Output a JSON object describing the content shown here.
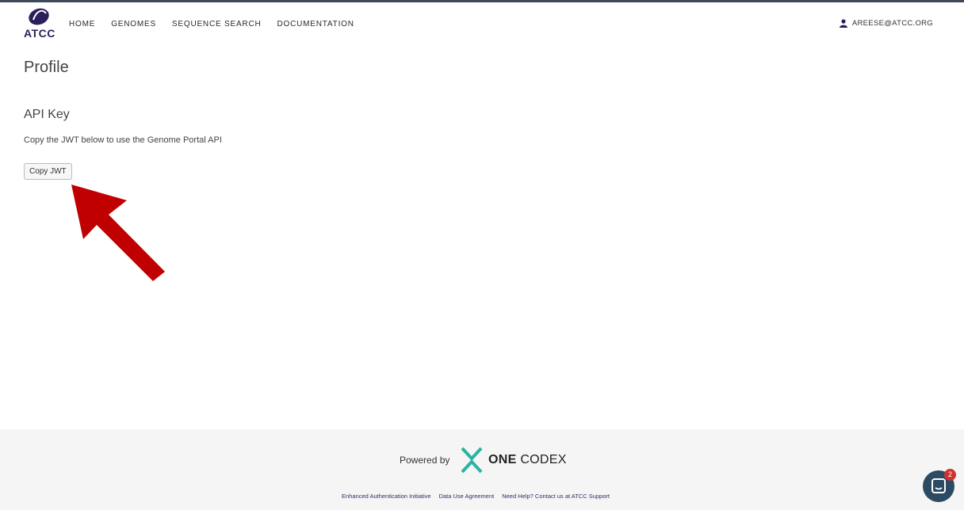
{
  "header": {
    "logo_text": "ATCC",
    "nav": [
      "HOME",
      "GENOMES",
      "SEQUENCE SEARCH",
      "DOCUMENTATION"
    ],
    "user_email": "AREESE@ATCC.ORG"
  },
  "main": {
    "title": "Profile",
    "api_key_heading": "API Key",
    "api_key_description": "Copy the JWT below to use the Genome Portal API",
    "copy_button": "Copy JWT"
  },
  "footer": {
    "powered_by": "Powered by",
    "brand_bold": "ONE",
    "brand_rest": " CODEX",
    "links": [
      "Enhanced Authentication Initiative",
      "Data Use Agreement",
      "Need Help? Contact us at ATCC Support"
    ]
  },
  "chat": {
    "badge_count": "2"
  },
  "colors": {
    "nav_bar": "#3d4a5c",
    "atcc_purple": "#2b1f5c",
    "arrow_red": "#c00000",
    "one_codex_teal": "#2bb3a3"
  }
}
